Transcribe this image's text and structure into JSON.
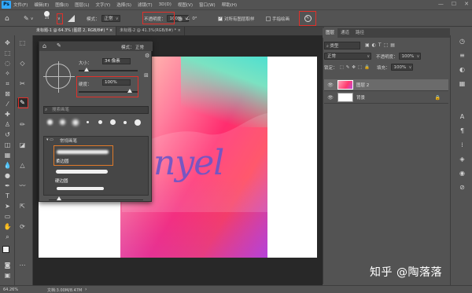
{
  "app": {
    "logo": "Ps"
  },
  "menu": [
    "文件(F)",
    "编辑(E)",
    "图像(I)",
    "图层(L)",
    "文字(Y)",
    "选择(S)",
    "滤镜(T)",
    "3D(D)",
    "视图(V)",
    "窗口(W)",
    "帮助(H)"
  ],
  "window_controls": {
    "minimize": "—",
    "maximize": "☐",
    "close": "✕"
  },
  "options": {
    "brush_size": "34",
    "mode_label": "模式：",
    "mode_value": "正常",
    "opacity_label": "不透明度：",
    "opacity_value": "100%",
    "flow_label": "流量：",
    "flow_value": "100%",
    "smoothing_label": "平滑：",
    "smoothing_value": "0%",
    "angle_value": "0°",
    "sample_all_label": "对所有图层取样",
    "hand_draw_label": "手指绘画"
  },
  "tabs": [
    {
      "label": "未标题-1 @ 64.3% (图层 2, RGB/8#) *  ×",
      "active": true
    },
    {
      "label": "未标题-2 @ 41.3%(RGB/8#) *  ×",
      "active": false
    }
  ],
  "brush_panel": {
    "mode_label": "模式：",
    "mode_value": "正常",
    "size_label": "大小：",
    "size_value": "34 像素",
    "hardness_label": "硬度：",
    "hardness_value": "100%",
    "search_placeholder": "搜索画笔",
    "preset_sizes": [
      "",
      "",
      "",
      "",
      "",
      "",
      "",
      ""
    ],
    "group_label": "常规画笔",
    "brushes": [
      "柔边圆",
      "硬边圆"
    ]
  },
  "layers_panel": {
    "tabs": [
      "图层",
      "通道",
      "路径"
    ],
    "kind_label": "类型",
    "blend_mode": "正常",
    "opacity_label": "不透明度：",
    "opacity_value": "100%",
    "lock_label": "锁定：",
    "fill_label": "填充：",
    "fill_value": "100%",
    "layers": [
      {
        "name": "图层 2",
        "selected": true
      },
      {
        "name": "背景",
        "selected": false
      }
    ]
  },
  "canvas": {
    "text": "nyel"
  },
  "status": {
    "zoom": "64.26%",
    "doc": "文档:3.00M/8.47M"
  },
  "watermark": "知乎 @陶落落",
  "colors": {
    "highlight": "#e0302a",
    "ps_blue": "#31a8ff"
  }
}
